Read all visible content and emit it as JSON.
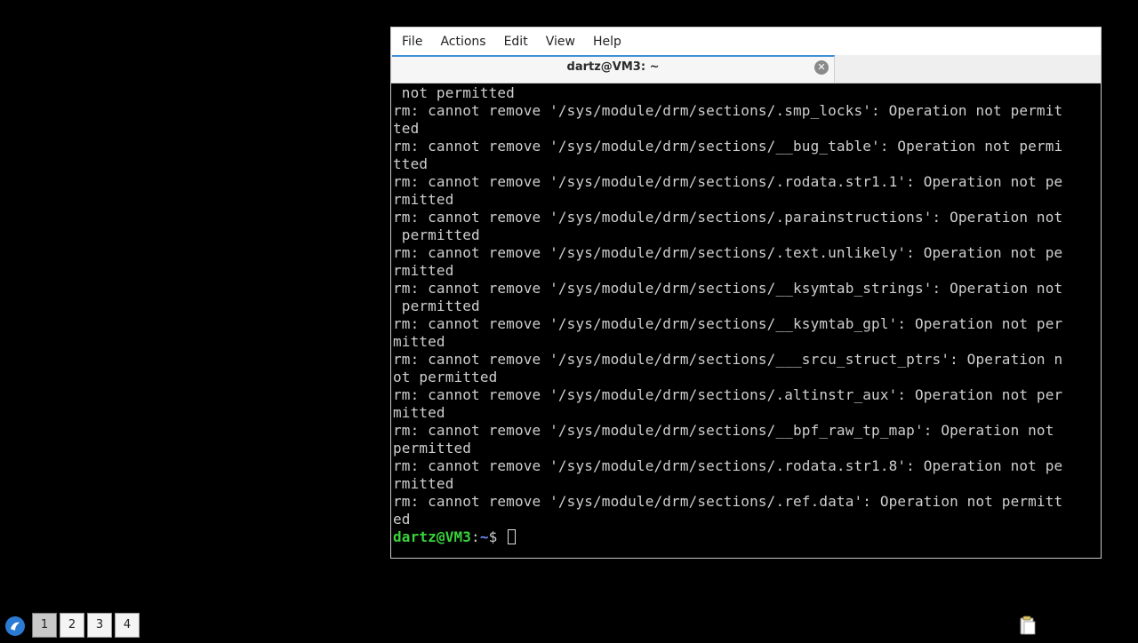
{
  "window": {
    "menu": [
      "File",
      "Actions",
      "Edit",
      "View",
      "Help"
    ],
    "tab_title": "dartz@VM3: ~",
    "tab_close_glyph": "✕"
  },
  "terminal": {
    "lines": [
      " not permitted",
      "rm: cannot remove '/sys/module/drm/sections/.smp_locks': Operation not permit",
      "ted",
      "rm: cannot remove '/sys/module/drm/sections/__bug_table': Operation not permi",
      "tted",
      "rm: cannot remove '/sys/module/drm/sections/.rodata.str1.1': Operation not pe",
      "rmitted",
      "rm: cannot remove '/sys/module/drm/sections/.parainstructions': Operation not",
      " permitted",
      "rm: cannot remove '/sys/module/drm/sections/.text.unlikely': Operation not pe",
      "rmitted",
      "rm: cannot remove '/sys/module/drm/sections/__ksymtab_strings': Operation not",
      " permitted",
      "rm: cannot remove '/sys/module/drm/sections/__ksymtab_gpl': Operation not per",
      "mitted",
      "rm: cannot remove '/sys/module/drm/sections/___srcu_struct_ptrs': Operation n",
      "ot permitted",
      "rm: cannot remove '/sys/module/drm/sections/.altinstr_aux': Operation not per",
      "mitted",
      "rm: cannot remove '/sys/module/drm/sections/__bpf_raw_tp_map': Operation not ",
      "permitted",
      "rm: cannot remove '/sys/module/drm/sections/.rodata.str1.8': Operation not pe",
      "rmitted",
      "rm: cannot remove '/sys/module/drm/sections/.ref.data': Operation not permitt",
      "ed"
    ],
    "prompt": {
      "user_host": "dartz@VM3",
      "separator": ":",
      "path": "~",
      "symbol": "$ "
    }
  },
  "taskbar": {
    "workspaces": [
      "1",
      "2",
      "3",
      "4"
    ],
    "active_workspace": "1",
    "start_icon": "lubuntu-start-icon",
    "tray_icon": "clipboard-icon"
  },
  "colors": {
    "prompt_user": "#3ad33a",
    "prompt_path": "#6b8ef5",
    "tab_accent": "#3d8fd6"
  }
}
